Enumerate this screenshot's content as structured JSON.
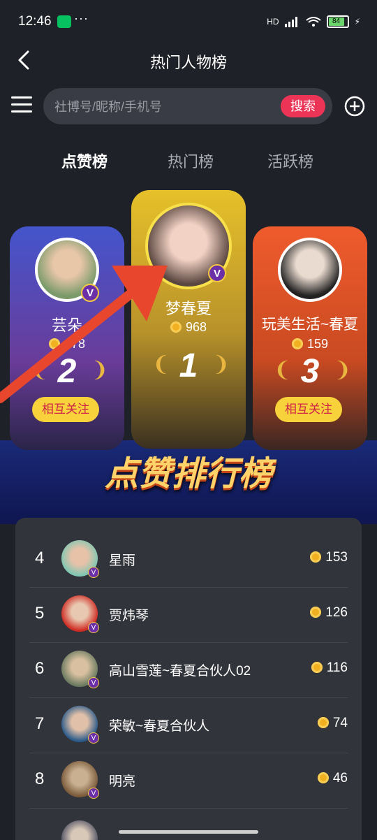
{
  "status": {
    "time": "12:46",
    "dots": "···",
    "network": "HD",
    "battery": "84"
  },
  "header": {
    "title": "热门人物榜"
  },
  "search": {
    "placeholder": "社博号/昵称/手机号",
    "button": "搜索"
  },
  "tabs": [
    "点赞榜",
    "热门榜",
    "活跃榜"
  ],
  "podium": {
    "first": {
      "name": "梦春夏",
      "likes": "968",
      "rank": "1"
    },
    "second": {
      "name": "芸朵",
      "likes": "178",
      "rank": "2",
      "follow": "相互关注"
    },
    "third": {
      "name": "玩美生活~春夏",
      "likes": "159",
      "rank": "3",
      "follow": "相互关注"
    },
    "banner": "点赞排行榜",
    "vip_letter": "V"
  },
  "list": [
    {
      "rank": "4",
      "name": "星雨",
      "score": "153"
    },
    {
      "rank": "5",
      "name": "贾炜琴",
      "score": "126"
    },
    {
      "rank": "6",
      "name": "高山雪莲~春夏合伙人02",
      "score": "116"
    },
    {
      "rank": "7",
      "name": "荣敏~春夏合伙人",
      "score": "74"
    },
    {
      "rank": "8",
      "name": "明亮",
      "score": "46"
    }
  ]
}
